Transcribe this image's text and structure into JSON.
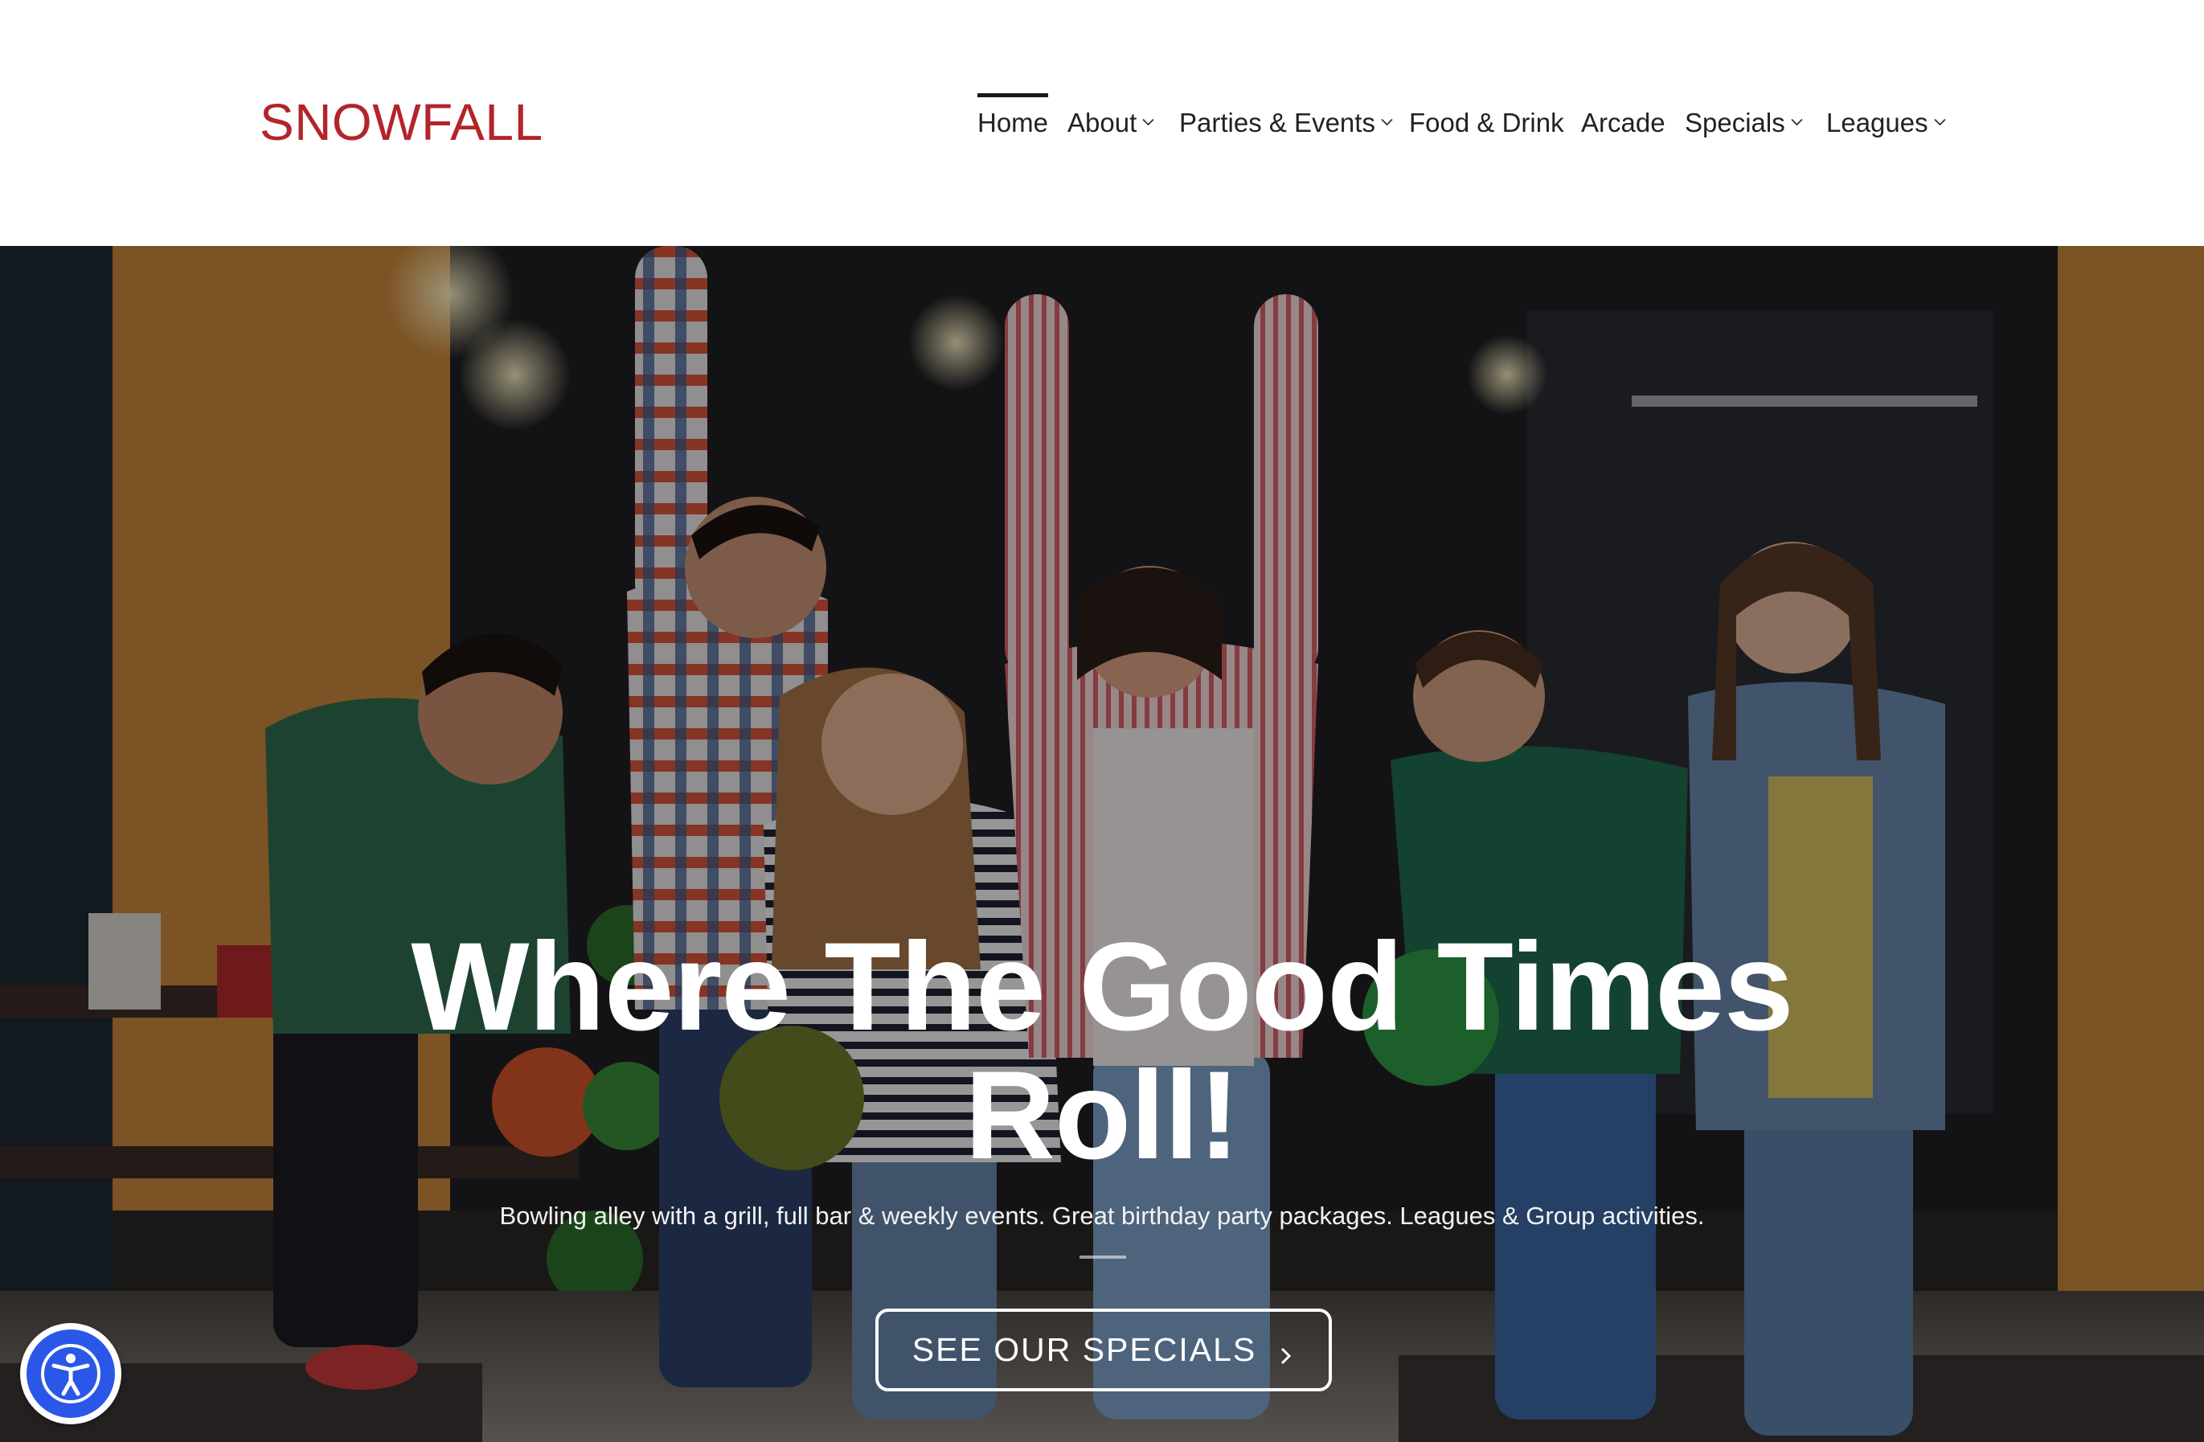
{
  "brand": {
    "logo_text": "SNOWFALL",
    "logo_color": "#b3242b"
  },
  "nav": {
    "items": [
      {
        "label": "Home",
        "active": true,
        "has_dropdown": false
      },
      {
        "label": "About",
        "active": false,
        "has_dropdown": true
      },
      {
        "label": "Parties & Events",
        "active": false,
        "has_dropdown": true
      },
      {
        "label": "Food & Drink",
        "active": false,
        "has_dropdown": false
      },
      {
        "label": "Arcade",
        "active": false,
        "has_dropdown": false
      },
      {
        "label": "Specials",
        "active": false,
        "has_dropdown": true
      },
      {
        "label": "Leagues",
        "active": false,
        "has_dropdown": true
      }
    ],
    "dropdown_icon": "chevron-down-icon"
  },
  "hero": {
    "title_line1": "Where The Good Times",
    "title_line2": "Roll!",
    "subtitle": "Bowling alley with a grill, full bar & weekly events. Great birthday party packages. Leagues & Group activities.",
    "cta_label": "SEE OUR SPECIALS",
    "cta_icon": "chevron-right-icon",
    "background_image": "group of friends celebrating at bowling alley"
  },
  "accessibility": {
    "icon": "accessibility-person-icon",
    "color": "#2a57e8"
  }
}
